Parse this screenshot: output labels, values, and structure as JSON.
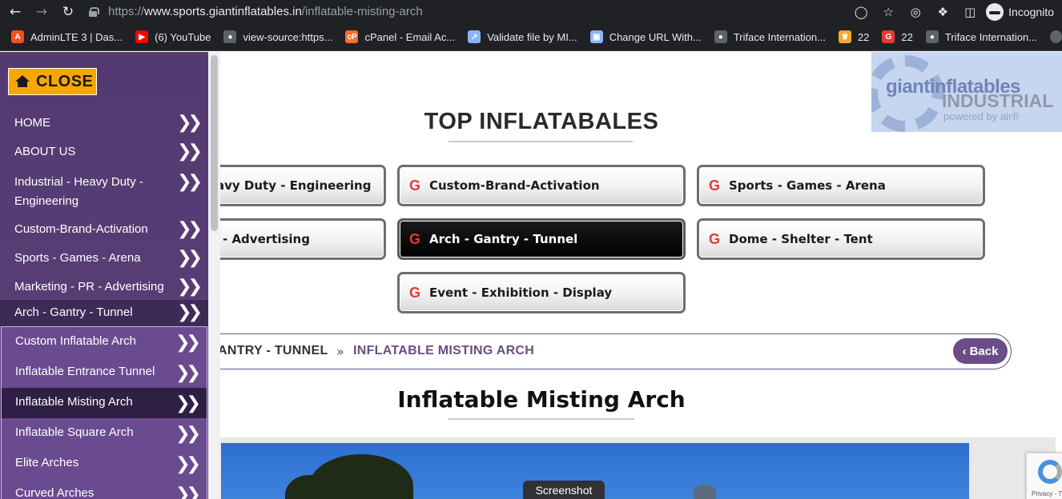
{
  "browser": {
    "url_scheme": "https://",
    "url_host": "www.sports.giantinflatables.in",
    "url_path": "/inflatable-misting-arch",
    "profile": "Incognito",
    "bookmarks": [
      {
        "label": "AdminLTE 3 | Das...",
        "icon": "adminlte-favicon-icon",
        "color": "#f4511e"
      },
      {
        "label": "(6) YouTube",
        "icon": "youtube-icon",
        "color": "#ff0000"
      },
      {
        "label": "view-source:https...",
        "icon": "globe-icon",
        "color": "#5f6368"
      },
      {
        "label": "cPanel - Email Ac...",
        "icon": "cpanel-icon",
        "color": "#ff6c2c"
      },
      {
        "label": "Validate file by MI...",
        "icon": "rocket-icon",
        "color": "#8ab4f8"
      },
      {
        "label": "Change URL With...",
        "icon": "page-icon",
        "color": "#8ab4f8"
      },
      {
        "label": "Triface Internation...",
        "icon": "globe-icon",
        "color": "#5f6368"
      },
      {
        "label": "22",
        "icon": "crown-icon",
        "color": "#f9a825"
      },
      {
        "label": "22",
        "icon": "g-logo-icon",
        "color": "#e53935"
      },
      {
        "label": "Triface Internation...",
        "icon": "globe-icon",
        "color": "#5f6368"
      }
    ]
  },
  "sidebar": {
    "close_label": "CLOSE",
    "items": [
      {
        "label": "HOME"
      },
      {
        "label": "ABOUT US"
      },
      {
        "label": "Industrial - Heavy Duty - Engineering"
      },
      {
        "label": "Custom-Brand-Activation"
      },
      {
        "label": "Sports - Games - Arena"
      },
      {
        "label": "Marketing - PR - Advertising"
      },
      {
        "label": "Arch - Gantry - Tunnel"
      }
    ],
    "subitems": [
      {
        "label": "Custom Inflatable Arch"
      },
      {
        "label": "Inflatable Entrance Tunnel"
      },
      {
        "label": "Inflatable Misting Arch"
      },
      {
        "label": "Inflatable Square Arch"
      },
      {
        "label": "Elite Arches"
      },
      {
        "label": "Curved Arches"
      }
    ]
  },
  "logo": {
    "line1": "giantinflatables",
    "line2": "INDUSTRIAL",
    "line3": "powered by air®"
  },
  "section_title": "TOP INFLATABALES",
  "categories": [
    {
      "label": "avy Duty - Engineering"
    },
    {
      "label": "Custom-Brand-Activation"
    },
    {
      "label": "Sports - Games - Arena"
    },
    {
      "label": "- Advertising"
    },
    {
      "label": "Arch - Gantry - Tunnel"
    },
    {
      "label": "Dome - Shelter - Tent"
    },
    {
      "label": "Event - Exhibition - Display"
    }
  ],
  "category_icon_letter": "G",
  "breadcrumb": {
    "previous": "ANTRY - TUNNEL",
    "separator": "»",
    "current": "INFLATABLE MISTING ARCH",
    "back_label": "Back"
  },
  "page_title": "Inflatable Misting Arch",
  "screenshot_label": "Screenshot",
  "recaptcha_text": "Privacy - T"
}
